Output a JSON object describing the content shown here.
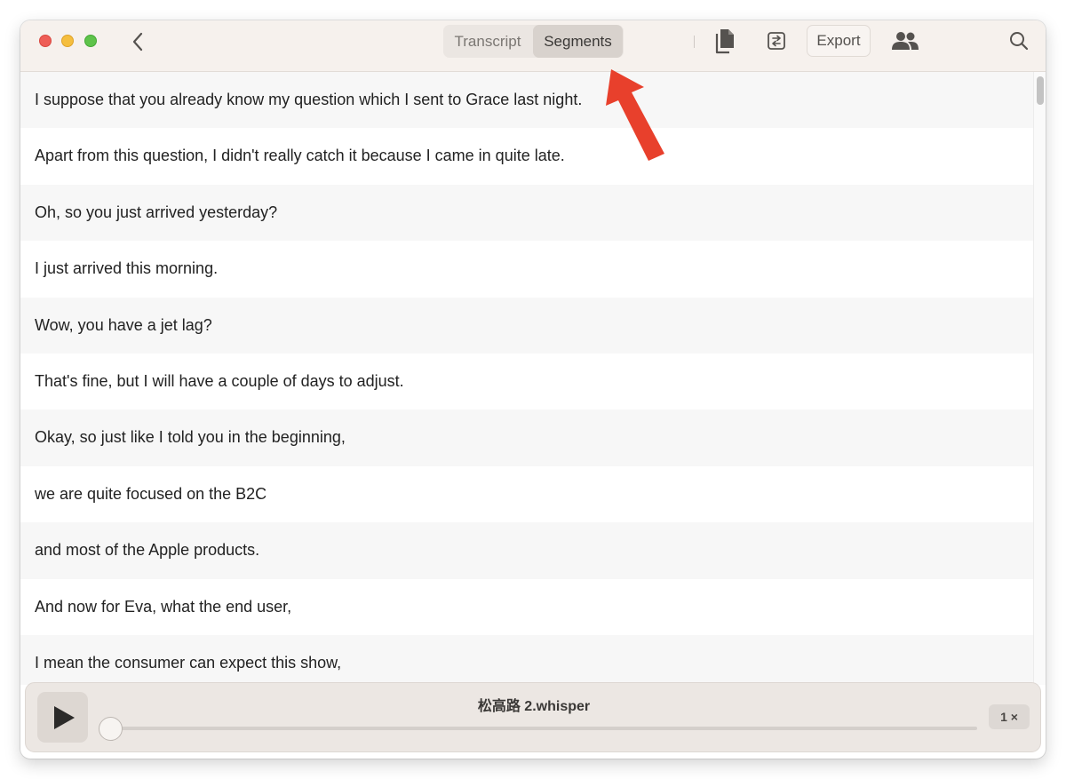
{
  "toolbar": {
    "tabs": [
      {
        "label": "Transcript",
        "selected": false
      },
      {
        "label": "Segments",
        "selected": true
      }
    ],
    "export_label": "Export",
    "icons": [
      "chevron-left-icon",
      "copy-icon",
      "swap-icon",
      "people-icon",
      "search-icon"
    ]
  },
  "segments": [
    "I suppose that you already know my question which I sent to Grace last night.",
    "Apart from this question, I didn't really catch it because I came in quite late.",
    "Oh, so you just arrived yesterday?",
    "I just arrived this morning.",
    "Wow, you have a jet lag?",
    "That's fine, but I will have a couple of days to adjust.",
    "Okay, so just like I told you in the beginning,",
    "we are quite focused on the B2C",
    "and most of the Apple products.",
    "And now for Eva, what the end user,",
    "I mean the consumer can expect this show,"
  ],
  "player": {
    "file_name": "松高路 2.whisper",
    "speed": "1 ×",
    "progress": 0.0
  },
  "colors": {
    "annotation_arrow": "#e8402c",
    "titlebar": "#f6f1ed"
  }
}
